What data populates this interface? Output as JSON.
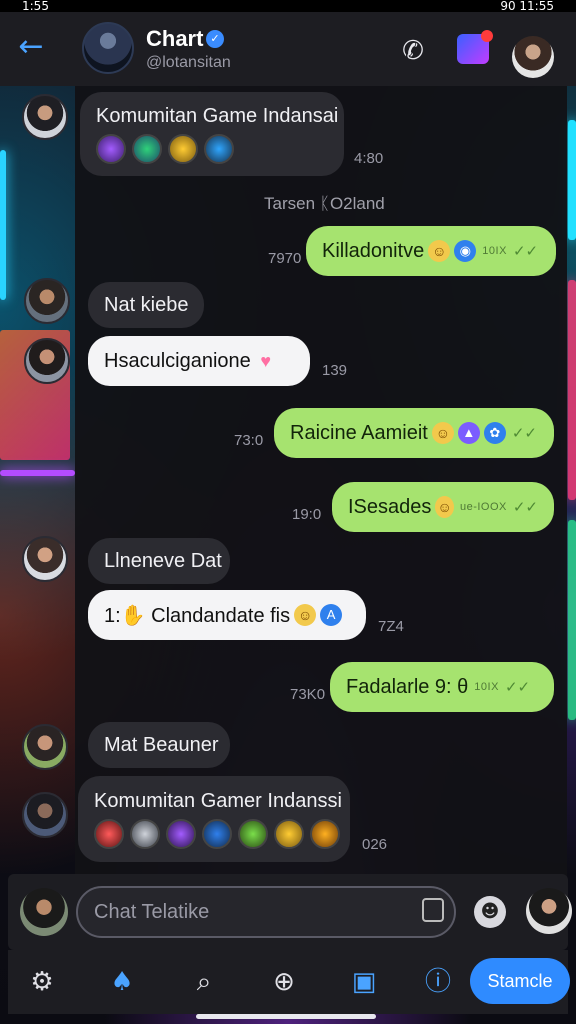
{
  "status_bar": {
    "time": "1:55",
    "right": "90 11:55"
  },
  "header": {
    "title": "Chart",
    "handle": "@lotansitan"
  },
  "messages": {
    "m1": {
      "text": "Komumitan Game Indansai",
      "time": "4:80"
    },
    "day": "Tarsen ᛕO2land",
    "m2": {
      "text": "Killadonitve",
      "tag": "10IX",
      "time": "7970"
    },
    "m3": {
      "text": "Nat kiebe"
    },
    "m4": {
      "text": "Hsaculciganione",
      "time": "139"
    },
    "m5": {
      "text": "Raicine Aamieit",
      "time": "73:0"
    },
    "m6": {
      "text": "ISesades",
      "tag": "ue-IOOX",
      "time": "19:0"
    },
    "m7": {
      "text": "Llneneve Dat"
    },
    "m8": {
      "text": "1:✋ Clandandate fis",
      "time": "7Z4"
    },
    "m9": {
      "text": "Fadalarle 9: θ",
      "tag": "10IX",
      "time": "73K0"
    },
    "m10": {
      "text": "Mat Beauner"
    },
    "m11": {
      "text": "Komumitan Gamer Indanssi",
      "time": "026"
    }
  },
  "input": {
    "placeholder": "Chat Telatike"
  },
  "nav": {
    "button_label": "Stamcle",
    "badge": "1"
  },
  "colors": {
    "accent": "#2f8bff",
    "outgoing": "#a6e36f",
    "incoming": "#2b2b31"
  }
}
